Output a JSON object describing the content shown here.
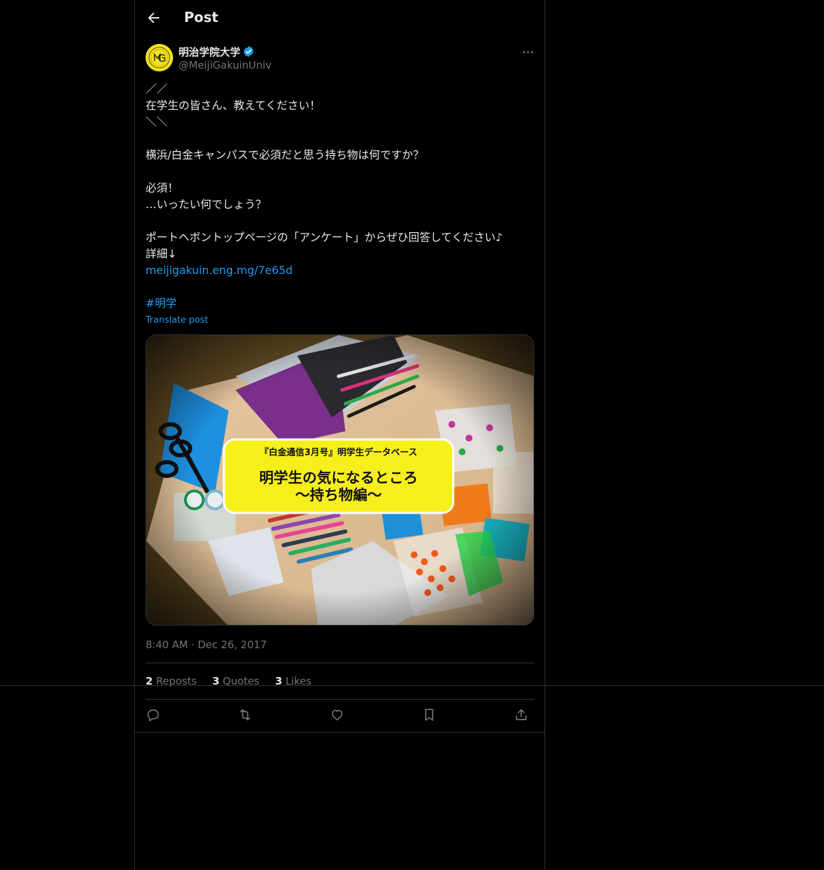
{
  "header": {
    "title": "Post"
  },
  "author": {
    "name": "明治学院大学",
    "handle": "@MeijiGakuinUniv"
  },
  "post": {
    "lines": [
      "／／",
      "在学生の皆さん、教えてください！",
      "＼＼",
      "",
      "横浜/白金キャンパスで必須だと思う持ち物は何ですか？",
      "",
      "必須！",
      "…いったい何でしょう？",
      "",
      "ポートヘボントップページの「アンケート」からぜひ回答してください♪",
      "詳細↓"
    ],
    "link": "meijigakuin.eng.mg/7e65d",
    "hashtag": "#明学",
    "translate": "Translate post"
  },
  "media": {
    "subtitle": "『白金通信3月号』明学生データベース",
    "title_line1": "明学生の気になるところ",
    "title_line2": "〜持ち物編〜"
  },
  "meta": {
    "time": "8:40 AM",
    "dot": "·",
    "date": "Dec 26, 2017"
  },
  "stats": {
    "reposts_count": "2",
    "reposts_label": "Reposts",
    "quotes_count": "3",
    "quotes_label": "Quotes",
    "likes_count": "3",
    "likes_label": "Likes"
  },
  "colors": {
    "accent": "#1d9bf0",
    "bg": "#000000",
    "text": "#e7e9ea",
    "muted": "#71767b",
    "border": "#2f3336"
  },
  "icons": [
    "back-arrow-icon",
    "verified-badge-icon",
    "more-icon",
    "reply-icon",
    "repost-icon",
    "like-icon",
    "bookmark-icon",
    "share-icon"
  ]
}
